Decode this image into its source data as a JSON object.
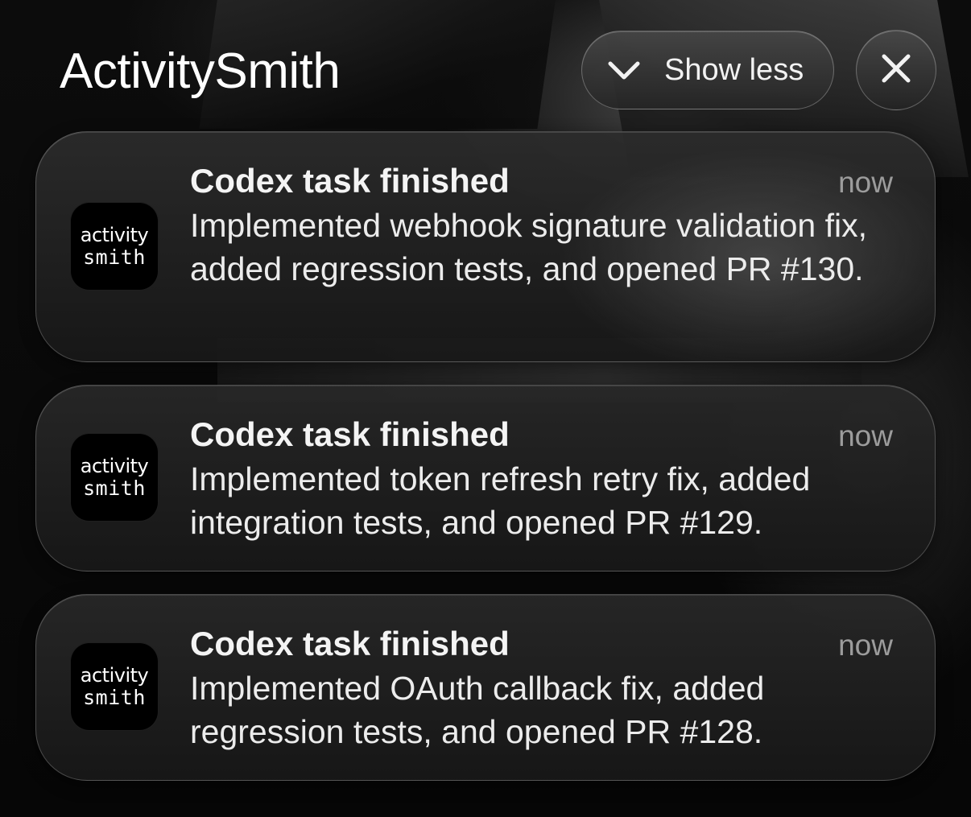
{
  "header": {
    "title": "ActivitySmith",
    "show_less_label": "Show less",
    "show_less_icon": "chevron-down-icon",
    "close_icon": "close-icon"
  },
  "app_icon": {
    "line1": "activity",
    "line2": "smith"
  },
  "notifications": [
    {
      "title": "Codex task finished",
      "time": "now",
      "body": "Implemented webhook signature validation fix, added regression tests, and opened PR #130."
    },
    {
      "title": "Codex task finished",
      "time": "now",
      "body": "Implemented token refresh retry fix, added integration tests, and opened PR #129."
    },
    {
      "title": "Codex task finished",
      "time": "now",
      "body": "Implemented OAuth callback fix, added regression tests, and opened PR #128."
    }
  ],
  "colors": {
    "background": "#050505",
    "card": "#262626",
    "text_primary": "#f4f4f4",
    "text_secondary": "#9c9c9c"
  }
}
